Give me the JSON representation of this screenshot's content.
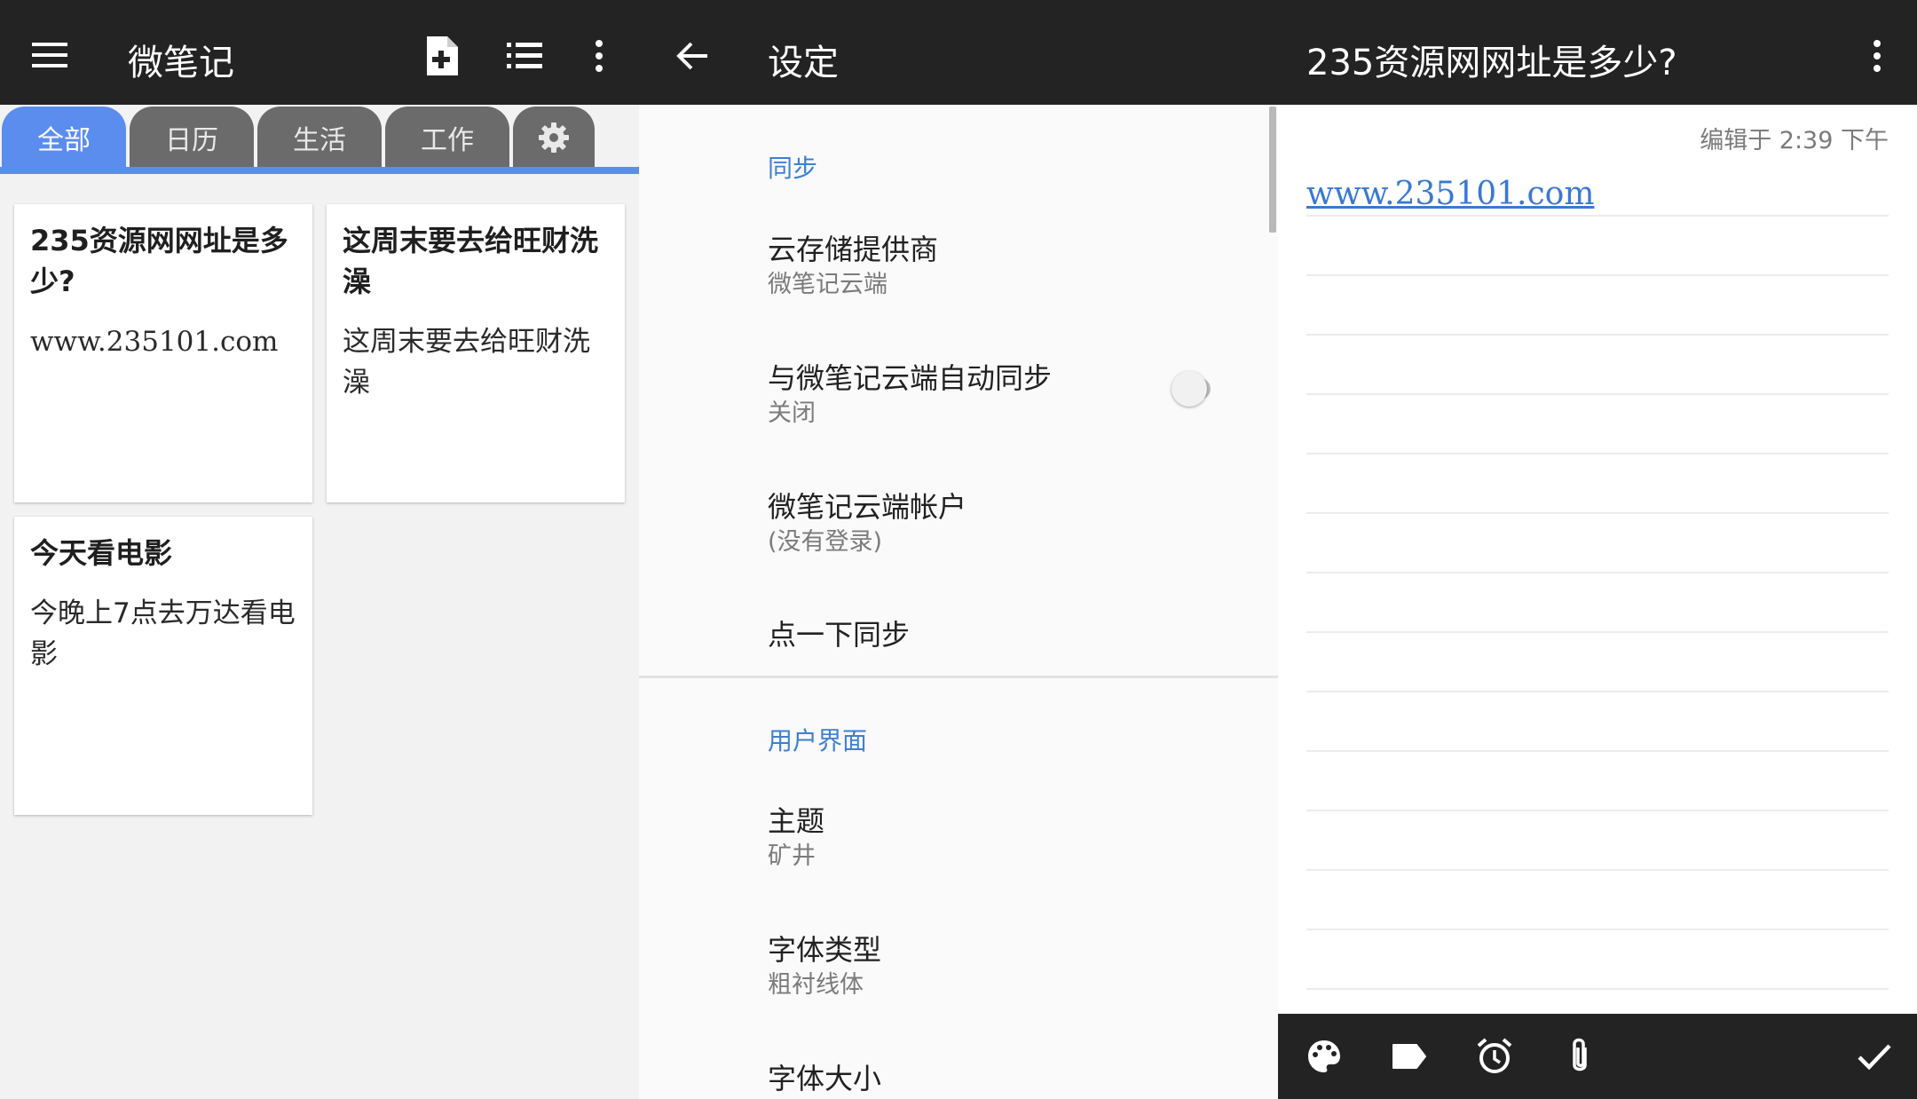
{
  "list_panel": {
    "app_title": "微笔记",
    "tabs": [
      "全部",
      "日历",
      "生活",
      "工作"
    ],
    "notes": [
      {
        "title": "235资源网网址是多少?",
        "body": "www.235101.com"
      },
      {
        "title": "这周末要去给旺财洗澡",
        "body": "这周末要去给旺财洗澡"
      },
      {
        "title": "今天看电影",
        "body": "今晚上7点去万达看电影"
      }
    ]
  },
  "settings_panel": {
    "title": "设定",
    "sections": [
      {
        "header": "同步",
        "items": [
          {
            "title": "云存储提供商",
            "subtitle": "微笔记云端"
          },
          {
            "title": "与微笔记云端自动同步",
            "subtitle": "关闭"
          },
          {
            "title": "微笔记云端帐户",
            "subtitle": "(没有登录)"
          },
          {
            "title": "点一下同步"
          }
        ]
      },
      {
        "header": "用户界面",
        "items": [
          {
            "title": "主题",
            "subtitle": "矿井"
          },
          {
            "title": "字体类型",
            "subtitle": "粗衬线体"
          },
          {
            "title": "字体大小"
          }
        ]
      }
    ]
  },
  "note_panel": {
    "title": "235资源网网址是多少?",
    "edited": "编辑于 2:39 下午",
    "link": "www.235101.com"
  },
  "colors": {
    "topbar": "#232323",
    "accent_blue": "#5b8def",
    "section_blue": "#3d7fd3",
    "tab_gray": "#6b6b6b"
  }
}
